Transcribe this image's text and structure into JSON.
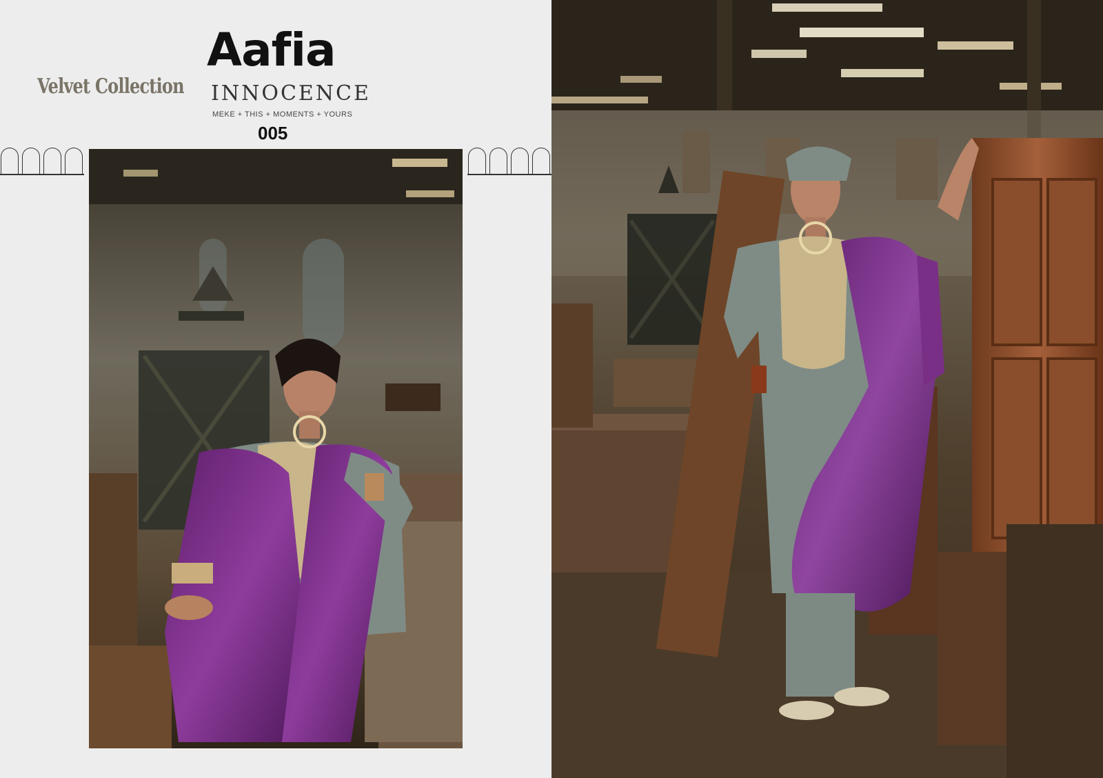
{
  "catalog": {
    "subtitle": "Velvet Collection",
    "brand": "Aafia",
    "series": "INNOCENCE",
    "tagline": "MEKE + THIS + MOMENTS + YOURS",
    "design_number": "005"
  },
  "colors": {
    "panel_bg": "#ededed",
    "velvet_purple": "#7a2f86",
    "suit_grey": "#7f8c86",
    "embroidery_gold": "#c9b58a",
    "wood_brown": "#8a4a28"
  }
}
